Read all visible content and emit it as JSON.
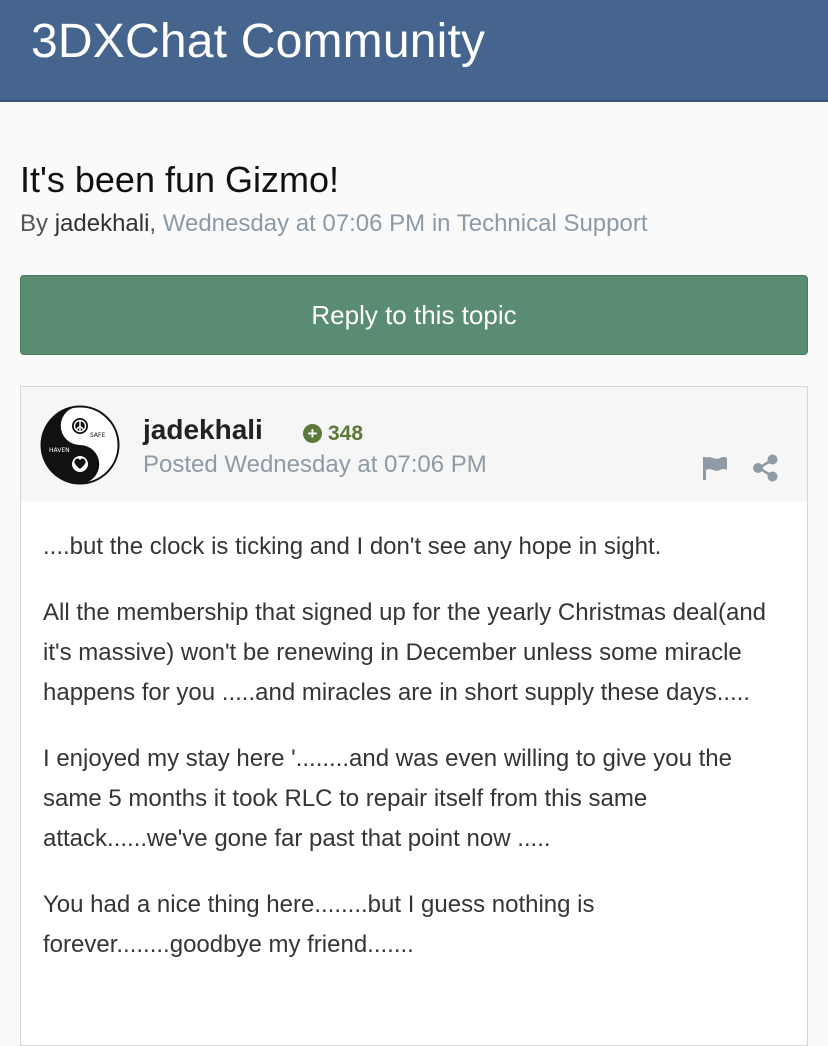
{
  "header": {
    "site_title": "3DXChat Community"
  },
  "topic": {
    "title": "It's been fun Gizmo!",
    "by_label": "By",
    "author": "jadekhali",
    "comma": ",",
    "meta": " Wednesday at 07:06 PM in Technical Support"
  },
  "reply_button": {
    "label": "Reply to this topic"
  },
  "post": {
    "username": "jadekhali",
    "reputation": "348",
    "posted": "Posted Wednesday at 07:06 PM",
    "avatar_text": {
      "left": "HAVEN",
      "right": "SAFE"
    },
    "paragraphs": [
      "....but the clock is ticking and I don't see any hope in sight.",
      "All the membership that signed up for the yearly Christmas deal(and it's massive)  won't be renewing in December unless some miracle happens for you .....and miracles are in short supply these days.....",
      "I enjoyed my stay here '........and was even willing to give you the same 5 months it took RLC to repair itself from this same attack......we've gone far past that point now .....",
      "You had a nice thing here........but I guess nothing is forever........goodbye my friend......."
    ]
  },
  "icons": {
    "reputation": "plus-circle-icon",
    "report": "flag-icon",
    "share": "share-icon",
    "avatar": "yin-yang-peace-heart"
  },
  "colors": {
    "header_bg": "#45658f",
    "reply_button_bg": "#5a8c72",
    "reputation": "#5b7a3a",
    "muted_text": "#8e9aa6"
  }
}
